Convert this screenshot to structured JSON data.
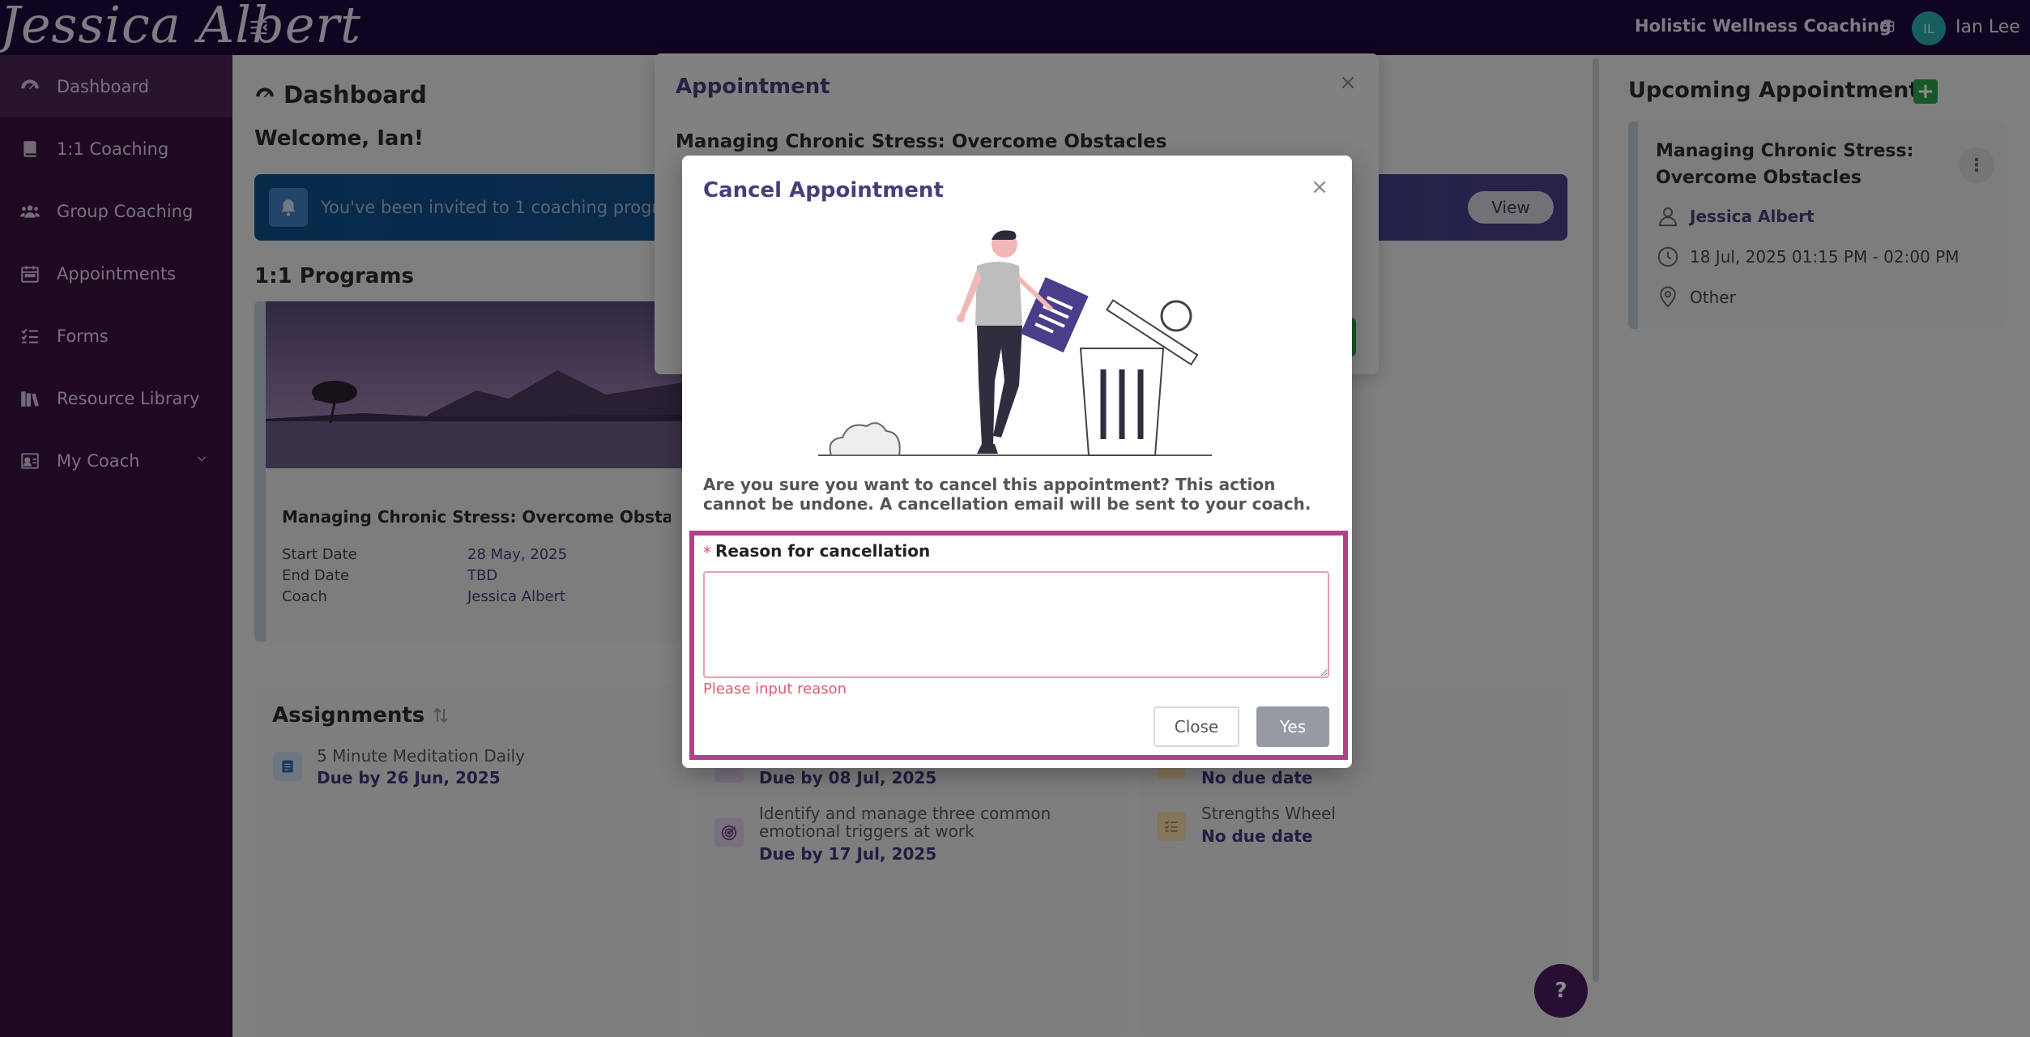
{
  "header": {
    "logo": "Jessica Albert",
    "business_name": "Holistic Wellness Coaching",
    "avatar_initials": "IL",
    "user_name": "Ian Lee"
  },
  "sidebar": {
    "items": [
      {
        "label": "Dashboard",
        "icon": "gauge-icon",
        "active": true
      },
      {
        "label": "1:1 Coaching",
        "icon": "book-icon"
      },
      {
        "label": "Group Coaching",
        "icon": "users-icon"
      },
      {
        "label": "Appointments",
        "icon": "calendar-icon"
      },
      {
        "label": "Forms",
        "icon": "checklist-icon"
      },
      {
        "label": "Resource Library",
        "icon": "books-icon"
      },
      {
        "label": "My Coach",
        "icon": "contact-card-icon"
      }
    ]
  },
  "dashboard": {
    "title": "Dashboard",
    "welcome": "Welcome, Ian!",
    "invite_text": "You've been invited to 1 coaching progr",
    "view_button": "View",
    "programs_title": "1:1 Programs",
    "program": {
      "name": "Managing Chronic Stress: Overcome Obsta...",
      "start_label": "Start Date",
      "start_value": "28 May, 2025",
      "end_label": "End Date",
      "end_value": "TBD",
      "coach_label": "Coach",
      "coach_value": "Jessica Albert"
    },
    "assignments_title": "Assignments",
    "assignments": [
      {
        "name": "5 Minute Meditation Daily",
        "due": "Due by 26 Jun, 2025"
      }
    ],
    "goals": [
      {
        "name": "",
        "due": "Due by 08 Jul, 2025"
      },
      {
        "name": "Identify and manage three common emotional triggers at work",
        "due": "Due by 17 Jul, 2025"
      }
    ],
    "forms": [
      {
        "name": "",
        "due": "No due date"
      },
      {
        "name": "Strengths Wheel",
        "due": "No due date"
      }
    ]
  },
  "upcoming": {
    "title": "Upcoming Appointments",
    "appointment": {
      "name": "Managing Chronic Stress: Overcome Obstacles",
      "coach": "Jessica Albert",
      "time": "18 Jul, 2025 01:15 PM - 02:00 PM",
      "location": "Other"
    }
  },
  "appointment_modal": {
    "title": "Appointment",
    "subtitle": "Managing Chronic Stress: Overcome Obstacles"
  },
  "cancel_modal": {
    "title": "Cancel Appointment",
    "message": "Are you sure you want to cancel this appointment? This action cannot be undone. A cancellation email will be sent to your coach.",
    "required_mark": "*",
    "reason_label": "Reason for cancellation",
    "reason_value": "",
    "error_text": "Please input reason",
    "close_button": "Close",
    "yes_button": "Yes"
  },
  "help_button": "?",
  "colors": {
    "topbar": "#1e0a3c",
    "sidebar": "#37103f",
    "accent": "#4a3d7a",
    "highlight": "#b0428a",
    "error": "#e05a6e"
  }
}
